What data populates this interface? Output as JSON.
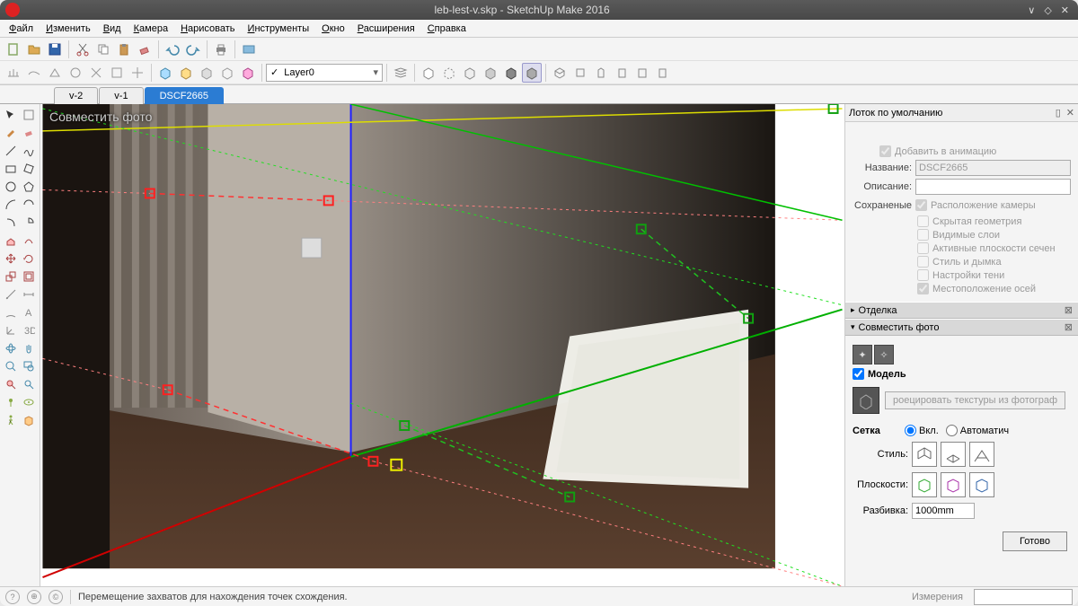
{
  "window": {
    "title": "leb-lest-v.skp - SketchUp Make 2016"
  },
  "menu": [
    "Файл",
    "Изменить",
    "Вид",
    "Камера",
    "Нарисовать",
    "Инструменты",
    "Окно",
    "Расширения",
    "Справка"
  ],
  "layer": {
    "current": "Layer0"
  },
  "scene_tabs": [
    {
      "label": "v-2",
      "active": false
    },
    {
      "label": "v-1",
      "active": false
    },
    {
      "label": "DSCF2665",
      "active": true
    }
  ],
  "viewport": {
    "mode_label": "Совместить фото"
  },
  "tray": {
    "title": "Лоток по умолчанию",
    "scene": {
      "add_anim": "Добавить в анимацию",
      "name_label": "Название:",
      "name_value": "DSCF2665",
      "desc_label": "Описание:",
      "saved_label": "Сохраненые",
      "opts": [
        "Расположение камеры",
        "Скрытая геометрия",
        "Видимые слои",
        "Активные плоскости сечен",
        "Стиль и дымка",
        "Настройки тени",
        "Местоположение осей"
      ]
    },
    "panels": {
      "otdelka": "Отделка",
      "match": "Совместить фото"
    },
    "match": {
      "model_label": "Модель",
      "proj_btn": "роецировать текстуры из фотограф",
      "grid_label": "Сетка",
      "grid_on": "Вкл.",
      "grid_auto": "Автоматич",
      "style_label": "Стиль:",
      "planes_label": "Плоскости:",
      "spacing_label": "Разбивка:",
      "spacing_value": "1000mm",
      "done": "Готово"
    }
  },
  "status": {
    "hint": "Перемещение захватов для нахождения точек схождения.",
    "meas_label": "Измерения"
  }
}
